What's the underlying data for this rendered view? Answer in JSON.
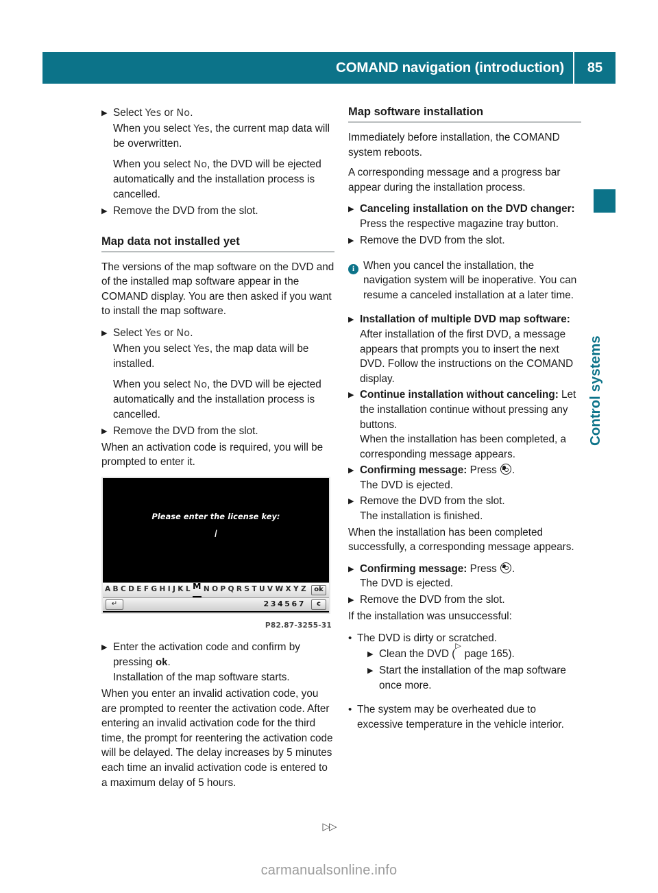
{
  "header": {
    "title": "COMAND navigation (introduction)",
    "page_number": "85",
    "accent_color": "#0c7389"
  },
  "side_tab": {
    "label": "Control systems"
  },
  "left_column": {
    "step_select_1": {
      "label": "Select ",
      "yes": "Yes",
      "or": " or ",
      "no": "No",
      "period": ".",
      "detail_yes_pre": "When you select ",
      "detail_yes_key": "Yes",
      "detail_yes_post": ", the current map data will be overwritten.",
      "detail_no_pre": "When you select ",
      "detail_no_key": "No",
      "detail_no_post": ", the DVD will be ejected automatically and the installation process is cancelled."
    },
    "step_remove_1": "Remove the DVD from the slot.",
    "heading": "Map data not installed yet",
    "intro_paragraph": "The versions of the map software on the DVD and of the installed map software appear in the COMAND display. You are then asked if you want to install the map software.",
    "step_select_2": {
      "label": "Select ",
      "yes": "Yes",
      "or": " or ",
      "no": "No",
      "period": ".",
      "detail_yes_pre": "When you select ",
      "detail_yes_key": "Yes",
      "detail_yes_post": ", the map data will be installed.",
      "detail_no_pre": "When you select ",
      "detail_no_key": "No",
      "detail_no_post": ", the DVD will be ejected automatically and the installation process is cancelled."
    },
    "step_remove_2": "Remove the DVD from the slot.",
    "activation_paragraph": "When an activation code is required, you will be prompted to enter it.",
    "figure": {
      "prompt": "Please enter the license key:",
      "cursor": "I",
      "keyboard_letters": [
        "A",
        "B",
        "C",
        "D",
        "E",
        "F",
        "G",
        "H",
        "I",
        "J",
        "K",
        "L",
        "M",
        "N",
        "O",
        "P",
        "Q",
        "R",
        "S",
        "T",
        "U",
        "V",
        "W",
        "X",
        "Y",
        "Z"
      ],
      "selected_letter": "M",
      "ok_button": "ok",
      "back_icon": "↵",
      "digits": "234567",
      "clear_button": "c",
      "caption": "P82.87-3255-31"
    },
    "step_enter_code_pre": "Enter the activation code and confirm by pressing ",
    "step_enter_code_key": "ok",
    "step_enter_code_post": ".",
    "step_enter_code_detail": "Installation of the map software starts.",
    "invalid_code_paragraph": "When you enter an invalid activation code, you are prompted to reenter the activation code. After entering an invalid activation code for the third time, the prompt for reentering the activation code will be delayed. The delay increases by 5 minutes each time an invalid activation code is entered to a maximum delay of 5 hours."
  },
  "right_column": {
    "heading": "Map software installation",
    "paragraph_reboot": "Immediately before installation, the COMAND system reboots.",
    "paragraph_progress": "A corresponding message and a progress bar appear during the installation process.",
    "step_cancel_changer_bold": "Canceling installation on the DVD changer:",
    "step_cancel_changer_rest": " Press the respective magazine tray button.",
    "step_remove_1": "Remove the DVD from the slot.",
    "note_cancel": "When you cancel the installation, the navigation system will be inoperative. You can resume a canceled installation at a later time.",
    "step_multiple_bold": "Installation of multiple DVD map software:",
    "step_multiple_rest": " After installation of the first DVD, a message appears that prompts you to insert the next DVD. Follow the instructions on the COMAND display.",
    "step_continue_bold": "Continue installation without canceling:",
    "step_continue_rest": " Let the installation continue without pressing any buttons.",
    "step_continue_detail": "When the installation has been completed, a corresponding message appears.",
    "step_confirm_1_bold": "Confirming message:",
    "step_confirm_1_rest": " Press ",
    "step_confirm_1_end": ".",
    "step_confirm_1_detail": "The DVD is ejected.",
    "step_remove_2": "Remove the DVD from the slot.",
    "step_remove_2_detail": "The installation is finished.",
    "paragraph_success": "When the installation has been completed successfully, a corresponding message appears.",
    "step_confirm_2_bold": "Confirming message:",
    "step_confirm_2_rest": " Press ",
    "step_confirm_2_end": ".",
    "step_confirm_2_detail": "The DVD is ejected.",
    "step_remove_3": "Remove the DVD from the slot.",
    "paragraph_unsuccessful": "If the installation was unsuccessful:",
    "bullet_dirty": "The DVD is dirty or scratched.",
    "sub_clean_pre": "Clean the DVD (",
    "sub_clean_ref": " page 165",
    "sub_clean_post": ").",
    "sub_restart": "Start the installation of the map software once more.",
    "bullet_overheated": "The system may be overheated due to excessive temperature in the vehicle interior."
  },
  "footer": {
    "continuation_arrows": "▷▷",
    "watermark": "carmanualsonline.info"
  }
}
